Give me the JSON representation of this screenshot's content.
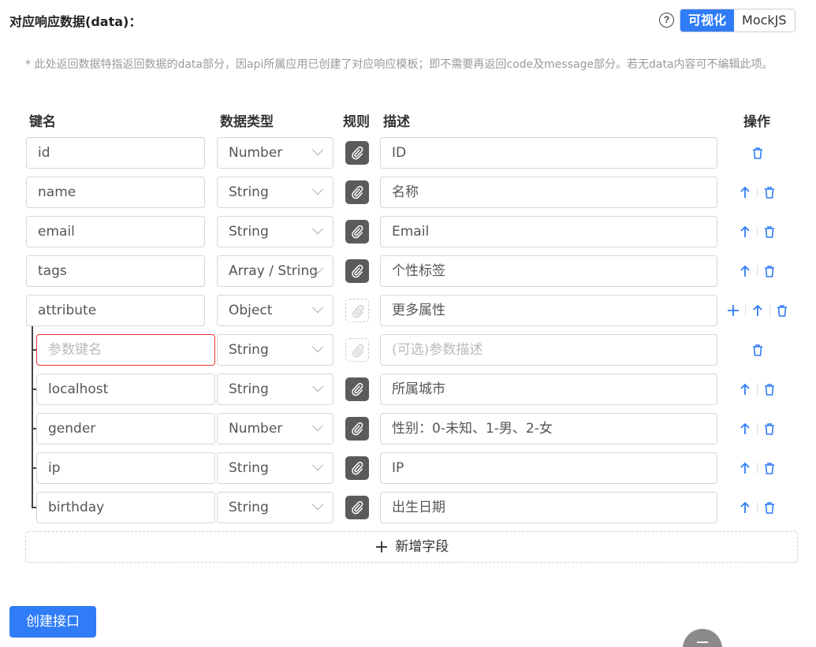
{
  "header": {
    "title": "对应响应数据(data)：",
    "toggle": {
      "visual_label": "可视化",
      "mock_label": "MockJS",
      "active": "可视化"
    }
  },
  "note": "* 此处返回数据特指返回数据的data部分，因api所属应用已创建了对应响应模板；即不需要再返回code及message部分。若无data内容可不编辑此项。",
  "columns": {
    "key": "键名",
    "type": "数据类型",
    "rule": "规则",
    "desc": "描述",
    "ops": "操作"
  },
  "fields": [
    {
      "key": "id",
      "type": "Number",
      "desc": "ID",
      "rule_enabled": true,
      "ops": [
        "delete"
      ]
    },
    {
      "key": "name",
      "type": "String",
      "desc": "名称",
      "rule_enabled": true,
      "ops": [
        "up",
        "delete"
      ]
    },
    {
      "key": "email",
      "type": "String",
      "desc": "Email",
      "rule_enabled": true,
      "ops": [
        "up",
        "delete"
      ]
    },
    {
      "key": "tags",
      "type": "Array / String",
      "desc": "个性标签",
      "rule_enabled": true,
      "ops": [
        "up",
        "delete"
      ]
    },
    {
      "key": "attribute",
      "type": "Object",
      "desc": "更多属性",
      "rule_enabled": false,
      "ops": [
        "add",
        "up",
        "delete"
      ]
    },
    {
      "key": "",
      "key_placeholder": "参数键名",
      "type": "String",
      "desc": "",
      "desc_placeholder": "(可选)参数描述",
      "rule_enabled": false,
      "ops": [
        "delete"
      ],
      "child": true,
      "error": true
    },
    {
      "key": "localhost",
      "type": "String",
      "desc": "所属城市",
      "rule_enabled": true,
      "ops": [
        "up",
        "delete"
      ],
      "child": true
    },
    {
      "key": "gender",
      "type": "Number",
      "desc": "性别：0-未知、1-男、2-女",
      "rule_enabled": true,
      "ops": [
        "up",
        "delete"
      ],
      "child": true
    },
    {
      "key": "ip",
      "type": "String",
      "desc": "IP",
      "rule_enabled": true,
      "ops": [
        "up",
        "delete"
      ],
      "child": true
    },
    {
      "key": "birthday",
      "type": "String",
      "desc": "出生日期",
      "rule_enabled": true,
      "ops": [
        "up",
        "delete"
      ],
      "child": true
    }
  ],
  "add_field_label": "新增字段",
  "create_button_label": "创建接口",
  "colors": {
    "accent": "#2f7cf6",
    "error": "#ee3333",
    "rule_bg": "#5b5b5b"
  }
}
